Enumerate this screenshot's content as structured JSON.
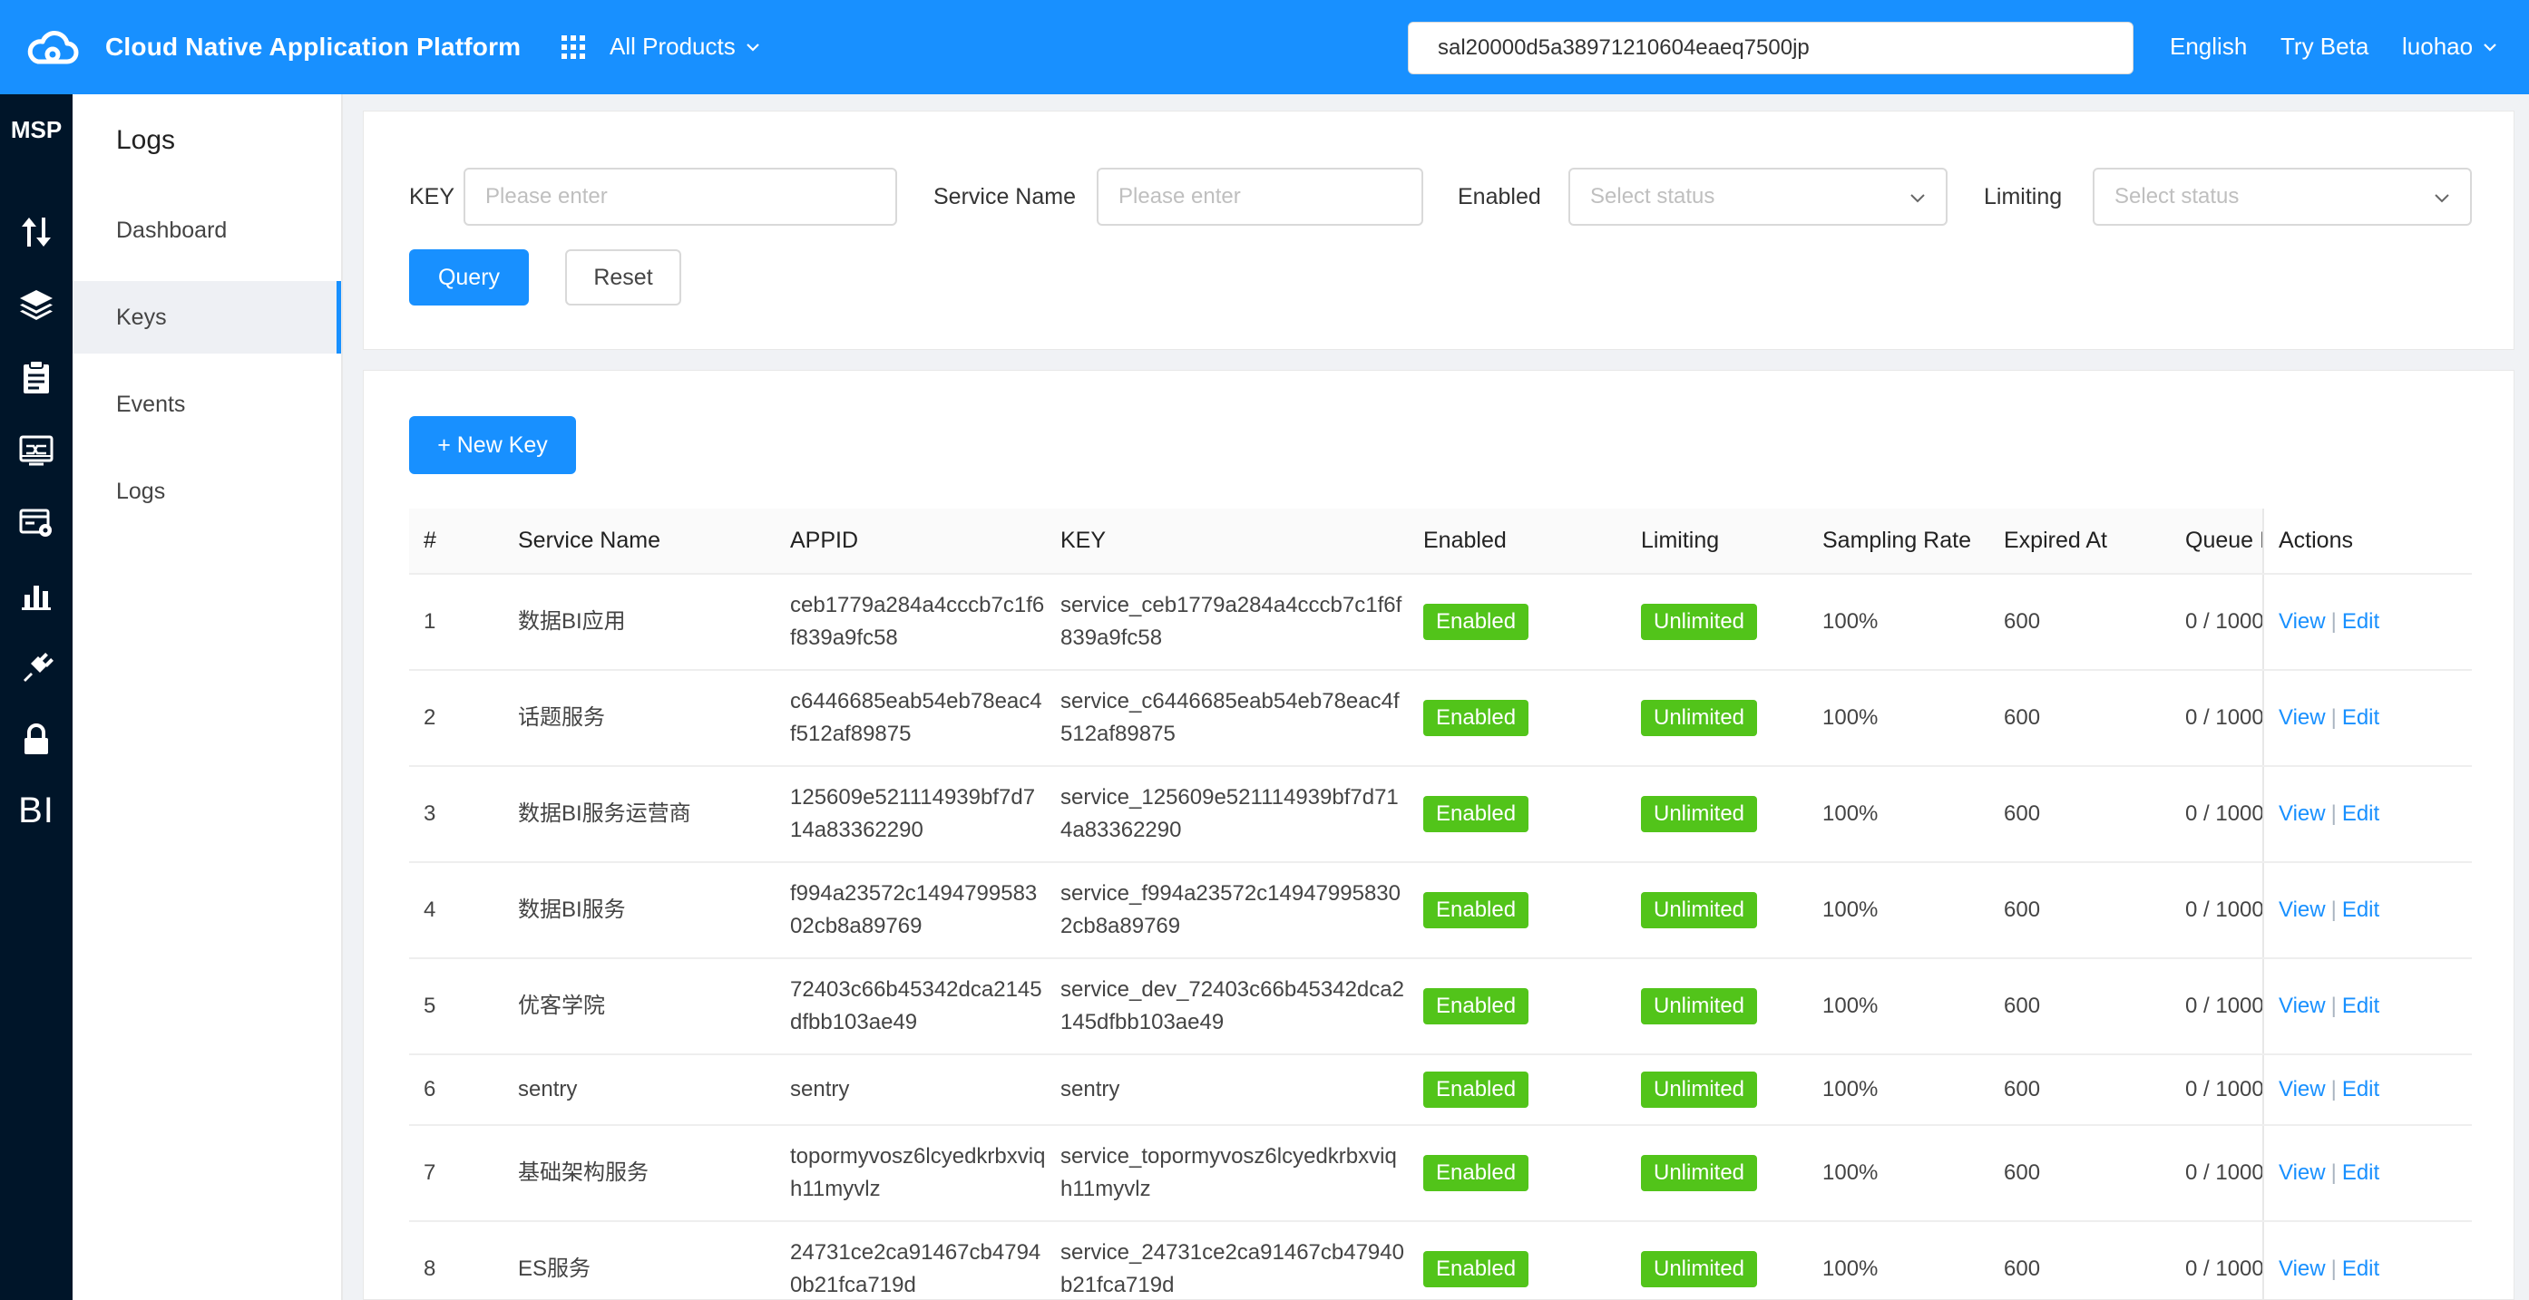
{
  "topbar": {
    "brand": "Cloud Native Application Platform",
    "products_label": "All Products",
    "search_value": "sal20000d5a38971210604eaeq7500jp",
    "language": "English",
    "try_beta": "Try Beta",
    "user": "luohao",
    "accent_color": "#1890ff"
  },
  "rail": {
    "title": "MSP",
    "icons": [
      "transfer-icon",
      "layers-icon",
      "clipboard-icon",
      "monitor-icon",
      "card-settings-icon",
      "bar-chart-icon",
      "plug-icon",
      "lock-icon"
    ],
    "bi_label": "BI"
  },
  "sidebar": {
    "title": "Logs",
    "items": [
      {
        "label": "Dashboard"
      },
      {
        "label": "Keys"
      },
      {
        "label": "Events"
      },
      {
        "label": "Logs"
      }
    ]
  },
  "filters": {
    "key_label": "KEY",
    "key_placeholder": "Please enter",
    "service_label": "Service Name",
    "service_placeholder": "Please enter",
    "enabled_label": "Enabled",
    "enabled_placeholder": "Select status",
    "limiting_label": "Limiting",
    "limiting_placeholder": "Select status",
    "query_button": "Query",
    "reset_button": "Reset"
  },
  "table": {
    "new_key_button": "+ New Key",
    "headers": [
      "#",
      "Service Name",
      "APPID",
      "KEY",
      "Enabled",
      "Limiting",
      "Sampling Rate",
      "Expired At",
      "Queue I",
      "Actions"
    ],
    "view_label": "View",
    "edit_label": "Edit",
    "rows": [
      {
        "num": "1",
        "service": "数据BI应用",
        "appid": "ceb1779a284a4cccb7c1f6f839a9fc58",
        "key": "service_ceb1779a284a4cccb7c1f6f839a9fc58",
        "enabled": "Enabled",
        "limiting": "Unlimited",
        "sampling": "100%",
        "expired": "600",
        "queue": "0 / 1000"
      },
      {
        "num": "2",
        "service": "话题服务",
        "appid": "c6446685eab54eb78eac4f512af89875",
        "key": "service_c6446685eab54eb78eac4f512af89875",
        "enabled": "Enabled",
        "limiting": "Unlimited",
        "sampling": "100%",
        "expired": "600",
        "queue": "0 / 1000"
      },
      {
        "num": "3",
        "service": "数据BI服务运营商",
        "appid": "125609e521114939bf7d714a83362290",
        "key": "service_125609e521114939bf7d714a83362290",
        "enabled": "Enabled",
        "limiting": "Unlimited",
        "sampling": "100%",
        "expired": "600",
        "queue": "0 / 1000"
      },
      {
        "num": "4",
        "service": "数据BI服务",
        "appid": "f994a23572c149479958302cb8a89769",
        "key": "service_f994a23572c149479958302cb8a89769",
        "enabled": "Enabled",
        "limiting": "Unlimited",
        "sampling": "100%",
        "expired": "600",
        "queue": "0 / 1000"
      },
      {
        "num": "5",
        "service": "优客学院",
        "appid": "72403c66b45342dca2145dfbb103ae49",
        "key": "service_dev_72403c66b45342dca2145dfbb103ae49",
        "enabled": "Enabled",
        "limiting": "Unlimited",
        "sampling": "100%",
        "expired": "600",
        "queue": "0 / 1000"
      },
      {
        "num": "6",
        "service": "sentry",
        "appid": "sentry",
        "key": "sentry",
        "enabled": "Enabled",
        "limiting": "Unlimited",
        "sampling": "100%",
        "expired": "600",
        "queue": "0 / 1000"
      },
      {
        "num": "7",
        "service": "基础架构服务",
        "appid": "topormyvosz6lcyedkrbxviqh11myvlz",
        "key": "service_topormyvosz6lcyedkrbxviqh11myvlz",
        "enabled": "Enabled",
        "limiting": "Unlimited",
        "sampling": "100%",
        "expired": "600",
        "queue": "0 / 1000"
      },
      {
        "num": "8",
        "service": "ES服务",
        "appid": "24731ce2ca91467cb47940b21fca719d",
        "key": "service_24731ce2ca91467cb47940b21fca719d",
        "enabled": "Enabled",
        "limiting": "Unlimited",
        "sampling": "100%",
        "expired": "600",
        "queue": "0 / 1000"
      }
    ]
  }
}
